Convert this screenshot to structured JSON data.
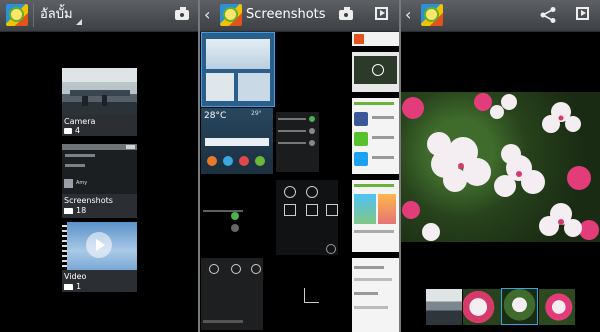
{
  "album_screen": {
    "title": "อัลบั้ม",
    "albums": [
      {
        "name": "Camera",
        "count": "4",
        "icon": "camera-icon"
      },
      {
        "name": "Screenshots",
        "count": "18",
        "icon": "folder-icon"
      },
      {
        "name": "Video",
        "count": "1",
        "icon": "folder-icon"
      }
    ],
    "screenshot_preview_text": "Amy"
  },
  "screenshots_screen": {
    "title": "Screenshots",
    "weather": {
      "temp": "28°C",
      "second_temp": "29°"
    }
  },
  "viewer_screen": {
    "icons": [
      "back-chevron-icon",
      "share-icon",
      "slideshow-icon"
    ]
  },
  "colors": {
    "bar_top": "#5d6166",
    "bar_bottom": "#3c4044",
    "selection_outline": "#3aa0e8",
    "background": "#000000"
  }
}
